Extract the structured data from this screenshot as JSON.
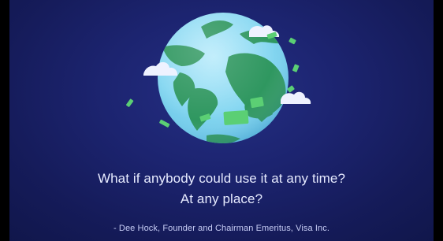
{
  "slide": {
    "quote_line_1": "What if anybody could use it at any time?",
    "quote_line_2": "At any place?",
    "attribution": "- Dee Hock, Founder and Chairman Emeritus, Visa Inc."
  },
  "icons": {
    "globe": "earth-globe-icon",
    "clouds": "cloud-icon",
    "money": "banknote-icon"
  },
  "colors": {
    "background": "#1c2470",
    "ocean": "#7fd2ef",
    "land": "#2f9760",
    "cash": "#5bcf74",
    "cloud": "#eef2ff",
    "quote_text": "#e7ebff"
  }
}
